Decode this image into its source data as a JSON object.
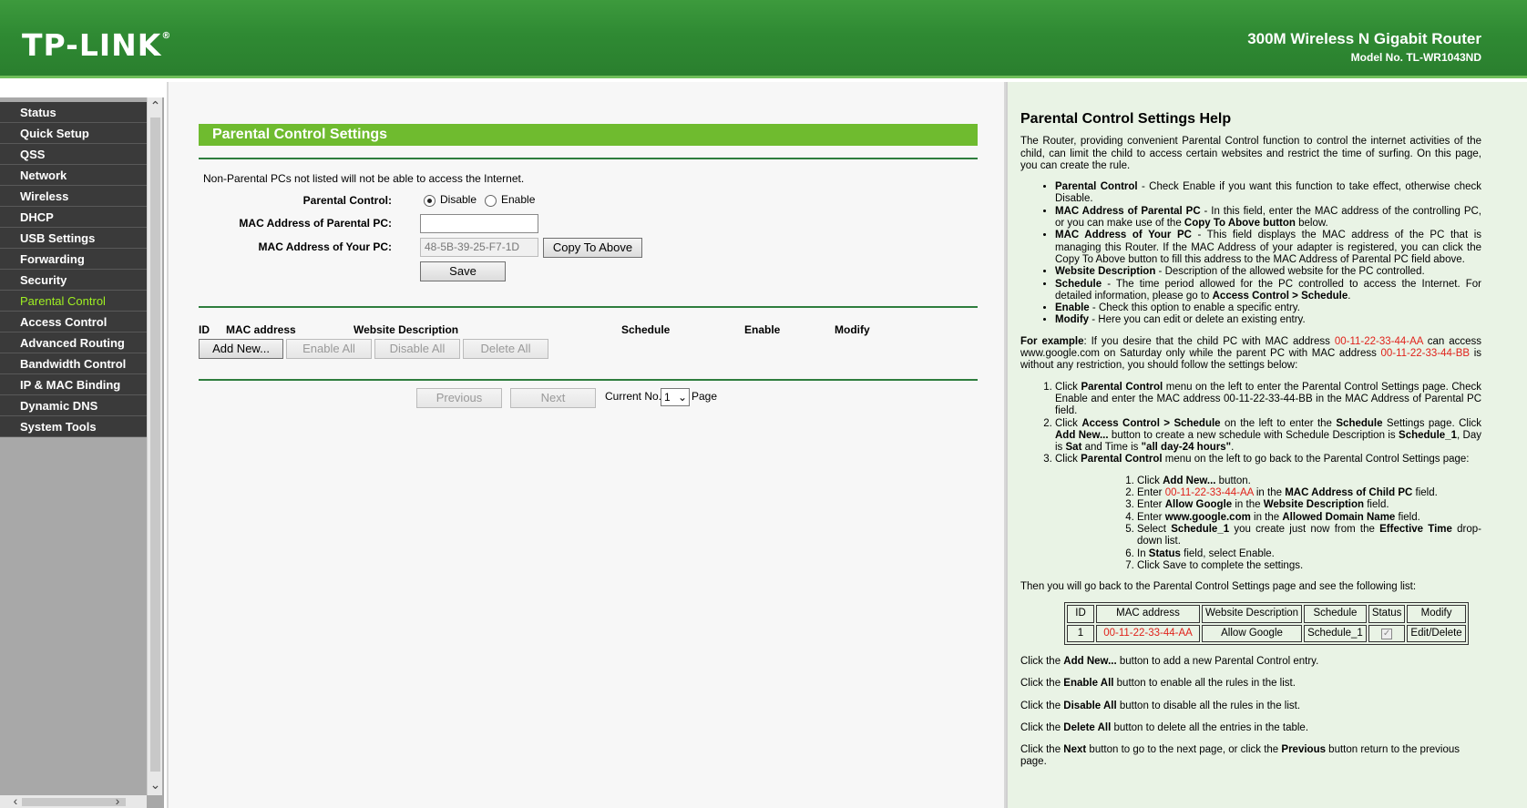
{
  "header": {
    "logo": "TP-LINK",
    "product_name": "300M Wireless N Gigabit Router",
    "model_no": "Model No. TL-WR1043ND"
  },
  "menu": {
    "items": [
      {
        "label": "Status"
      },
      {
        "label": "Quick Setup"
      },
      {
        "label": "QSS"
      },
      {
        "label": "Network"
      },
      {
        "label": "Wireless"
      },
      {
        "label": "DHCP"
      },
      {
        "label": "USB Settings"
      },
      {
        "label": "Forwarding"
      },
      {
        "label": "Security"
      },
      {
        "label": "Parental Control",
        "active": true
      },
      {
        "label": "Access Control"
      },
      {
        "label": "Advanced Routing"
      },
      {
        "label": "Bandwidth Control"
      },
      {
        "label": "IP & MAC Binding"
      },
      {
        "label": "Dynamic DNS"
      },
      {
        "label": "System Tools"
      }
    ]
  },
  "main": {
    "title": "Parental Control Settings",
    "note": "Non-Parental PCs not listed will not be able to access the Internet.",
    "parental_control_label": "Parental Control:",
    "disable_label": "Disable",
    "enable_label": "Enable",
    "selected_mode": "Disable",
    "mac_parental_label": "MAC Address of Parental PC:",
    "mac_parental_value": "",
    "mac_your_label": "MAC Address of Your PC:",
    "mac_your_value": "48-5B-39-25-F7-1D",
    "copy_button": "Copy To Above",
    "save_button": "Save",
    "table_headers": {
      "id": "ID",
      "mac": "MAC address",
      "website": "Website Description",
      "schedule": "Schedule",
      "enable": "Enable",
      "modify": "Modify"
    },
    "add_new_button": "Add New...",
    "enable_all_button": "Enable All",
    "disable_all_button": "Disable All",
    "delete_all_button": "Delete All",
    "previous_button": "Previous",
    "next_button": "Next",
    "current_no_label": "Current No.",
    "current_page": "1",
    "page_label": "Page"
  },
  "help": {
    "title": "Parental Control Settings Help",
    "intro": "The Router, providing convenient Parental Control function to control the internet activities of the child, can limit the child to access certain websites and restrict the time of surfing. On this page, you can create the rule.",
    "items": [
      {
        "term": "Parental Control",
        "text": " - Check Enable if you want this function to take effect, otherwise check Disable."
      },
      {
        "term": "MAC Address of Parental PC",
        "text": " - In this field, enter the MAC address of the controlling PC, or you can make use of the ",
        "term2": "Copy To Above button",
        "text2": " below."
      },
      {
        "term": "MAC Address of Your PC",
        "text": " - This field displays the MAC address of the PC that is managing this Router. If the MAC Address of your adapter is registered, you can click the Copy To Above button to fill this address to the MAC Address of Parental PC field above."
      },
      {
        "term": "Website Description",
        "text": " - Description of the allowed website for the PC controlled."
      },
      {
        "term": "Schedule",
        "text": " - The time period allowed for the PC controlled to access the Internet. For detailed information, please go to ",
        "term2": "Access Control > Schedule",
        "text2": "."
      },
      {
        "term": "Enable",
        "text": " - Check this option to enable a specific entry."
      },
      {
        "term": "Modify",
        "text": " - Here you can edit or delete an existing entry."
      }
    ],
    "example": {
      "lead": "For example",
      "p1": ": If you desire that the child PC with MAC address ",
      "mac_child": "00-11-22-33-44-AA",
      "p2": " can access www.google.com on Saturday only while the parent PC with MAC address ",
      "mac_parent": "00-11-22-33-44-BB",
      "p3": " is without any restriction, you should follow the settings below:"
    },
    "steps": {
      "s1a": "Click ",
      "s1b": "Parental Control",
      "s1c": " menu on the left to enter the Parental Control Settings page. Check Enable and enter the MAC address 00-11-22-33-44-BB in the MAC Address of Parental PC field.",
      "s2a": "Click ",
      "s2b": "Access Control > Schedule",
      "s2c": " on the left to enter the ",
      "s2d": "Schedule",
      "s2e": " Settings page. Click ",
      "s2f": "Add New...",
      "s2g": " button to create a new schedule with Schedule Description is ",
      "s2h": "Schedule_1",
      "s2i": ", Day is ",
      "s2j": "Sat",
      "s2k": " and Time is ",
      "s2l": "\"all day-24 hours\"",
      "s2m": ".",
      "s3a": "Click ",
      "s3b": "Parental Control",
      "s3c": " menu on the left to go back to the Parental Control Settings page:"
    },
    "substeps": {
      "a1": "Click ",
      "a2": "Add New...",
      "a3": " button.",
      "b1": "Enter ",
      "b2": "00-11-22-33-44-AA",
      "b3": " in the ",
      "b4": "MAC Address of Child PC",
      "b5": " field.",
      "c1": "Enter ",
      "c2": "Allow Google",
      "c3": " in the ",
      "c4": "Website Description",
      "c5": " field.",
      "d1": "Enter ",
      "d2": "www.google.com",
      "d3": " in the ",
      "d4": "Allowed Domain Name",
      "d5": " field.",
      "e1": "Select ",
      "e2": "Schedule_1",
      "e3": " you create just now from the ",
      "e4": "Effective Time",
      "e5": " drop-down list.",
      "f1": "In ",
      "f2": "Status",
      "f3": " field, select Enable.",
      "g1": "Click Save to complete the settings."
    },
    "list_intro": "Then you will go back to the Parental Control Settings page and see the following list:",
    "table": {
      "headers": [
        "ID",
        "MAC address",
        "Website Description",
        "Schedule",
        "Status",
        "Modify"
      ],
      "row": {
        "id": "1",
        "mac": "00-11-22-33-44-AA",
        "website": "Allow Google",
        "schedule": "Schedule_1",
        "modify": "Edit/Delete"
      }
    },
    "lines": {
      "l1a": "Click the ",
      "l1b": "Add New...",
      "l1c": " button to add a new Parental Control entry.",
      "l2a": "Click the ",
      "l2b": "Enable All",
      "l2c": " button to enable all the rules in the list.",
      "l3a": "Click the ",
      "l3b": "Disable All",
      "l3c": " button to disable all the rules in the list.",
      "l4a": "Click the ",
      "l4b": "Delete All",
      "l4c": " button to delete all the entries in the table.",
      "l5a": "Click the ",
      "l5b": "Next",
      "l5c": " button to go to the next page, or click the ",
      "l5d": "Previous",
      "l5e": " button return to the previous page."
    }
  },
  "colors": {
    "header_green": "#2f8a33",
    "title_bar_green": "#6fbb2f",
    "active_menu": "#9ff022",
    "menu_bg": "#3a3a3a",
    "help_bg": "#e9f3e5",
    "red_text": "#e0221b"
  }
}
